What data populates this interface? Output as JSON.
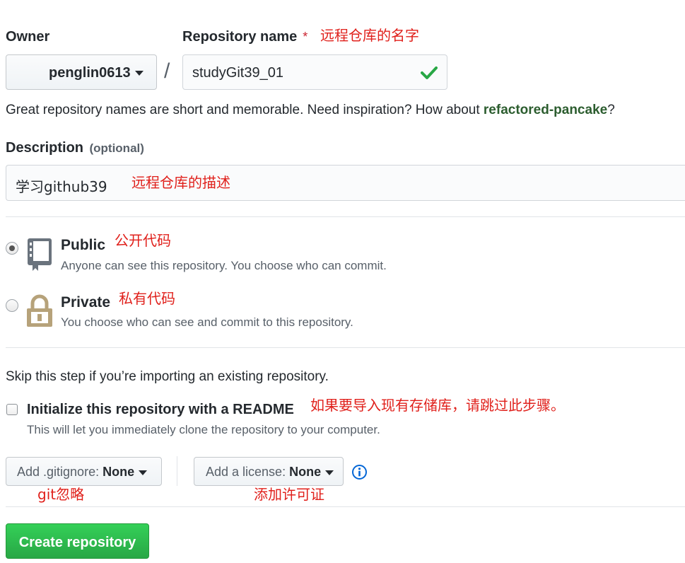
{
  "owner": {
    "label": "Owner",
    "value": "penglin0613"
  },
  "separator": "/",
  "repo_name": {
    "label": "Repository name",
    "required_mark": "*",
    "value": "studyGit39_01",
    "annotation": "远程仓库的名字"
  },
  "hint": {
    "prefix": "Great repository names are short and memorable. Need inspiration? How about",
    "suggestion": "refactored-pancake",
    "suffix": "?"
  },
  "description": {
    "label": "Description",
    "optional": "(optional)",
    "value": "学习github39",
    "annotation": "远程仓库的描述"
  },
  "visibility": {
    "public": {
      "title": "Public",
      "annotation": "公开代码",
      "desc": "Anyone can see this repository. You choose who can commit.",
      "checked": true
    },
    "private": {
      "title": "Private",
      "annotation": "私有代码",
      "desc": "You choose who can see and commit to this repository.",
      "checked": false
    }
  },
  "import_note": "Skip this step if you’re importing an existing repository.",
  "readme": {
    "label": "Initialize this repository with a README",
    "annotation": "如果要导入现有存储库，请跳过此步骤。",
    "desc": "This will let you immediately clone the repository to your computer.",
    "checked": false
  },
  "gitignore": {
    "prefix": "Add .gitignore:",
    "value": "None",
    "annotation": "git忽略"
  },
  "license": {
    "prefix": "Add a license:",
    "value": "None",
    "annotation": "添加许可证"
  },
  "create_button": "Create repository",
  "colors": {
    "primary_green": "#2ea44f",
    "check_green": "#28a745",
    "annotation_red": "#e0201b",
    "info_blue": "#0366d6"
  },
  "icons": [
    "chevron-down-icon",
    "check-icon",
    "repo-icon",
    "lock-icon",
    "info-icon"
  ]
}
